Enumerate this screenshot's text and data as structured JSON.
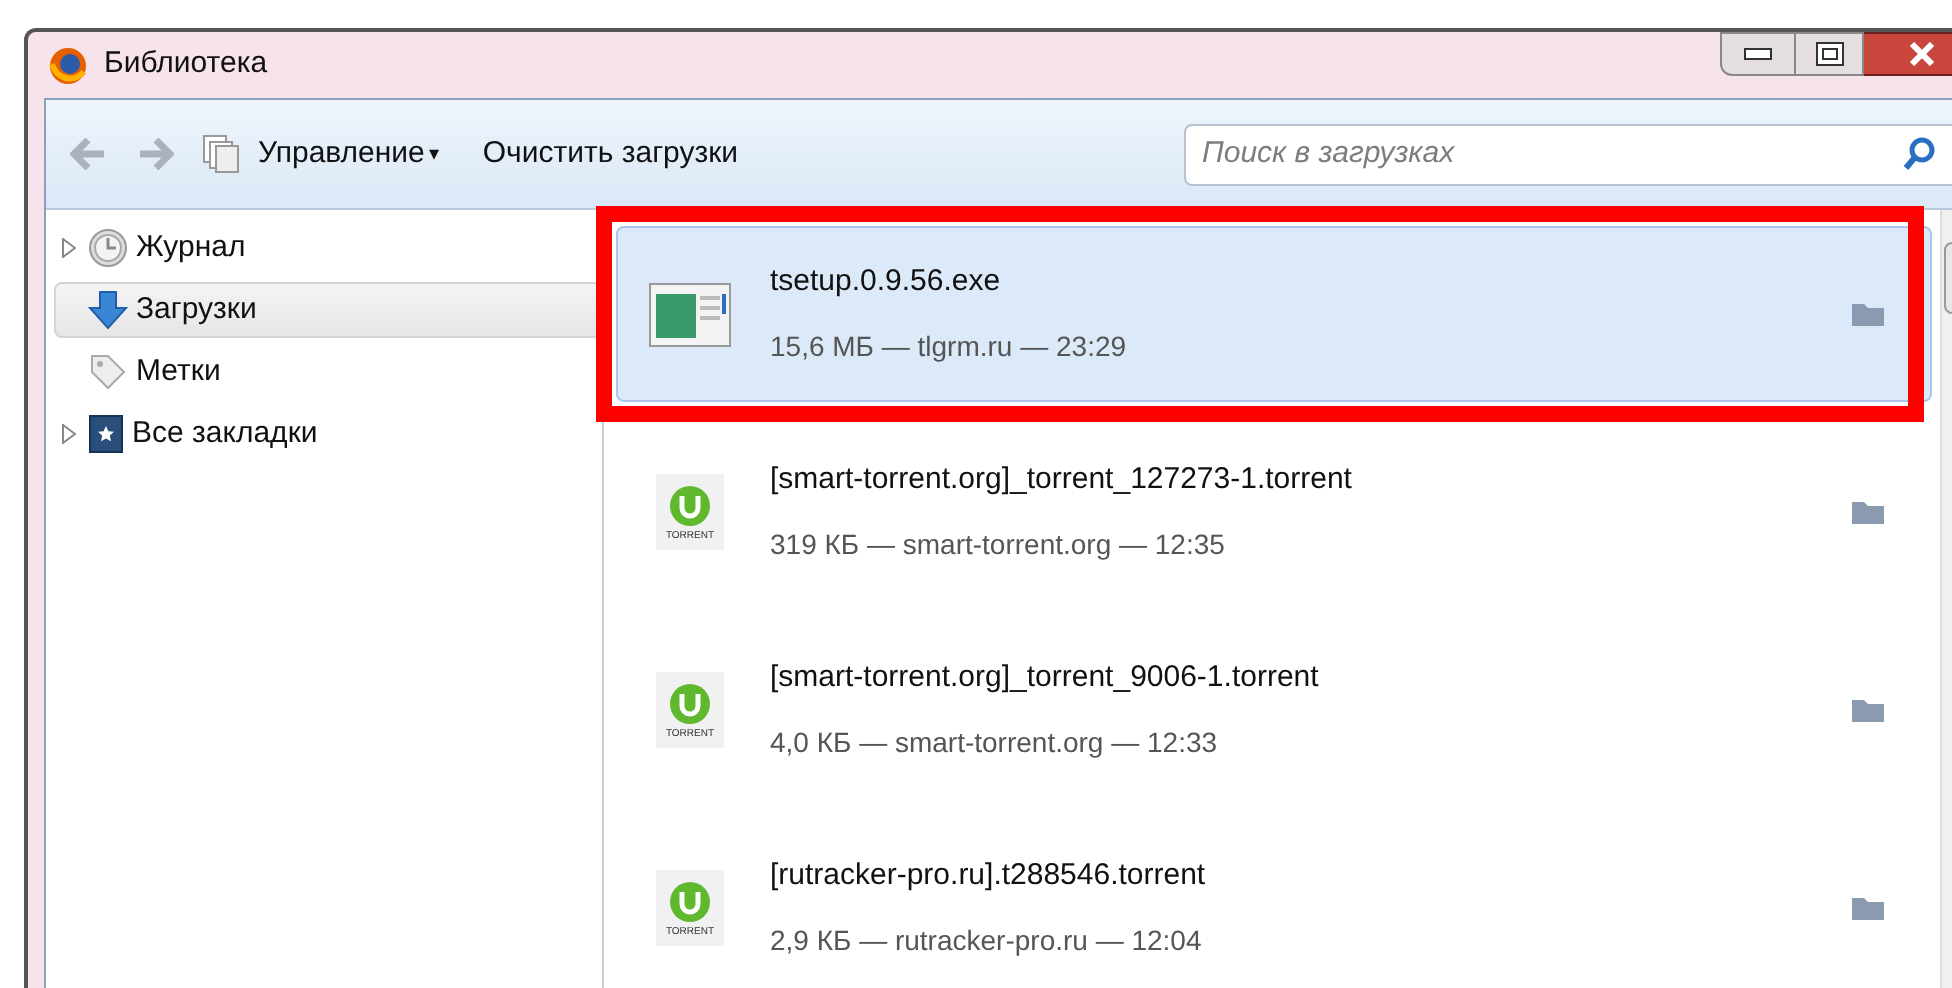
{
  "window": {
    "title": "Библиотека"
  },
  "toolbar": {
    "manage": "Управление",
    "manage_caret": "▾",
    "clear": "Очистить загрузки",
    "search": {
      "placeholder": "Поиск в загрузках"
    }
  },
  "sidebar": {
    "items": [
      {
        "label": "Журнал",
        "kind": "history",
        "expandable": true,
        "selected": false
      },
      {
        "label": "Загрузки",
        "kind": "downloads",
        "expandable": false,
        "selected": true
      },
      {
        "label": "Метки",
        "kind": "tags",
        "expandable": false,
        "selected": false
      },
      {
        "label": "Все закладки",
        "kind": "bookmarks",
        "expandable": true,
        "selected": false
      }
    ]
  },
  "downloads": [
    {
      "name": "tsetup.0.9.56.exe",
      "details": "15,6 МБ — tlgrm.ru — 23:29",
      "kind": "exe",
      "selected": true,
      "highlighted": true
    },
    {
      "name": "[smart-torrent.org]_torrent_127273-1.torrent",
      "details": "319 КБ — smart-torrent.org — 12:35",
      "kind": "torrent",
      "icon_label": "TORRENT",
      "selected": false,
      "highlighted": false
    },
    {
      "name": "[smart-torrent.org]_torrent_9006-1.torrent",
      "details": "4,0 КБ — smart-torrent.org — 12:33",
      "kind": "torrent",
      "icon_label": "TORRENT",
      "selected": false,
      "highlighted": false
    },
    {
      "name": "[rutracker-pro.ru].t288546.torrent",
      "details": "2,9 КБ — rutracker-pro.ru — 12:04",
      "kind": "torrent",
      "icon_label": "TORRENT",
      "selected": false,
      "highlighted": false
    }
  ]
}
